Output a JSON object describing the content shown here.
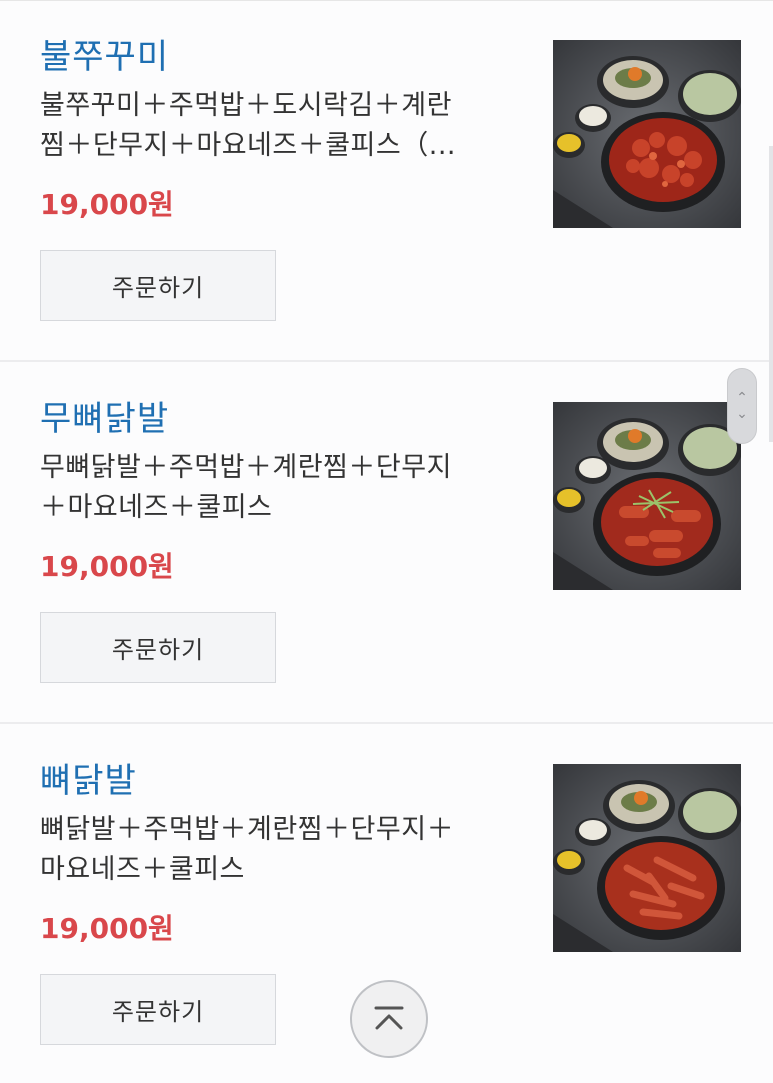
{
  "menu_items": [
    {
      "title": "불쭈꾸미",
      "desc_lines": [
        "불쭈꾸미＋주먹밥＋도시락김＋계란",
        "찜＋단무지＋마요네즈＋쿨피스（..."
      ],
      "price": "19,000원",
      "order_label": "주문하기",
      "image_icon": "food-photo-jjukkumi"
    },
    {
      "title": "무뼈닭발",
      "desc_lines": [
        "무뼈닭발＋주먹밥＋계란찜＋단무지",
        "＋마요네즈＋쿨피스"
      ],
      "price": "19,000원",
      "order_label": "주문하기",
      "image_icon": "food-photo-boneless-chicken-feet"
    },
    {
      "title": "뼈닭발",
      "desc_lines": [
        "뼈닭발＋주먹밥＋계란찜＋단무지＋",
        "마요네즈＋쿨피스"
      ],
      "price": "19,000원",
      "order_label": "주문하기",
      "image_icon": "food-photo-chicken-feet"
    }
  ],
  "colors": {
    "title": "#1f6fb2",
    "price": "#d9474b",
    "button_bg": "#f4f5f7"
  }
}
